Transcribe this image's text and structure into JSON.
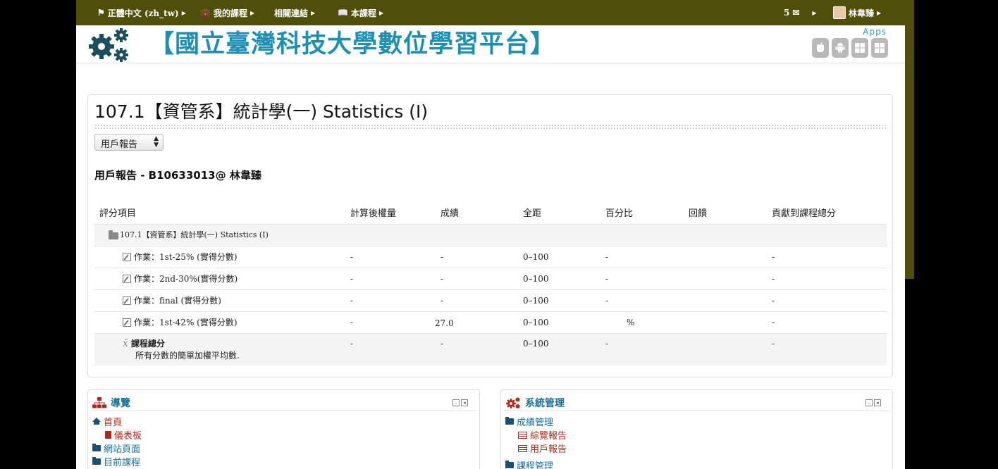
{
  "topbar": {
    "language": "正體中文 (zh_tw)",
    "my_courses": "我的課程",
    "links": "相關連結",
    "this_course": "本課程",
    "message_count": "5",
    "user_name": "林韋臻"
  },
  "banner": {
    "title": "【國立臺灣科技大學數位學習平台】",
    "apps_label": "Apps",
    "app_icons": [
      "apple-icon",
      "android-icon",
      "windows-icon",
      "windows-phone-icon"
    ]
  },
  "course": {
    "title": "107.1【資管系】統計學(一) Statistics (I)",
    "report_select": "用戶報告",
    "report_heading": "用戶報告 - B10633013@ 林韋臻"
  },
  "grade_table": {
    "headers": {
      "item": "評分項目",
      "weight": "計算後權量",
      "grade": "成績",
      "range": "全距",
      "percentage": "百分比",
      "feedback": "回饋",
      "contribution": "貢獻到課程總分"
    },
    "category": "107.1【資管系】統計學(一) Statistics (I)",
    "rows": [
      {
        "item": "作業：1st-25% (實得分數)",
        "weight": "-",
        "grade": "-",
        "range": "0–100",
        "percentage": "-",
        "feedback": "",
        "contribution": "-"
      },
      {
        "item": "作業：2nd-30%(實得分數)",
        "weight": "-",
        "grade": "-",
        "range": "0–100",
        "percentage": "-",
        "feedback": "",
        "contribution": "-"
      },
      {
        "item": "作業：final (實得分數)",
        "weight": "-",
        "grade": "-",
        "range": "0–100",
        "percentage": "-",
        "feedback": "",
        "contribution": "-"
      },
      {
        "item": "作業：1st-42% (實得分數)",
        "weight": "-",
        "grade": "27.0",
        "range": "0–100",
        "percentage": "%",
        "feedback": "",
        "contribution": "-"
      }
    ],
    "total": {
      "label": "課程總分",
      "description": "所有分數的簡單加權平均數.",
      "weight": "-",
      "grade": "-",
      "range": "0–100",
      "percentage": "-",
      "contribution": "-"
    }
  },
  "navigation": {
    "title": "導覽",
    "items": [
      "首頁",
      "儀表板",
      "網站頁面",
      "目前課程"
    ]
  },
  "administration": {
    "title": "系統管理",
    "items": [
      "成績管理",
      "綜覽報告",
      "用戶報告",
      "課程管理"
    ]
  },
  "colors": {
    "topbar": "#4f4f0a",
    "banner_title": "#1e8fb3",
    "block_title": "#1b6f97",
    "link_red": "#b0281c"
  }
}
